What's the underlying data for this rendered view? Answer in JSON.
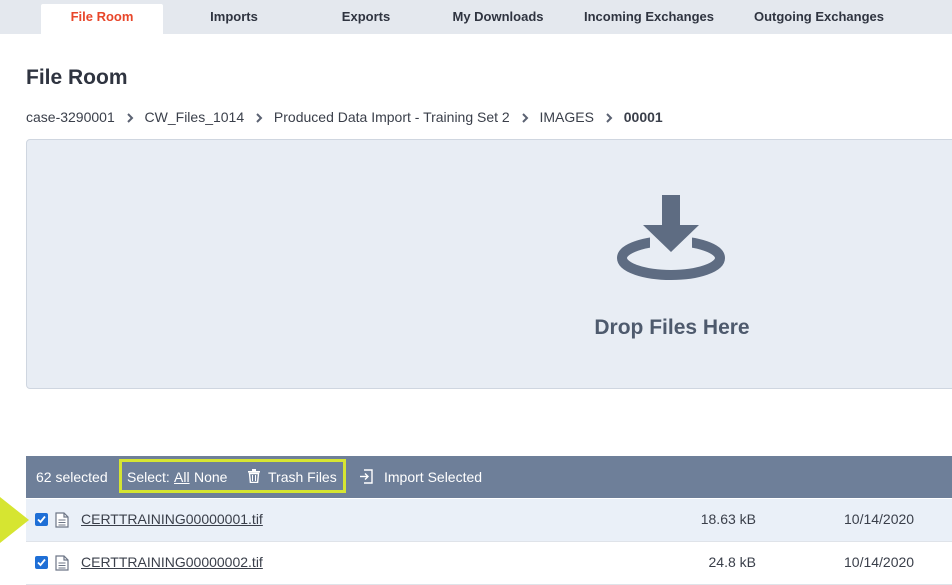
{
  "tabs": [
    {
      "label": "File Room",
      "active": true
    },
    {
      "label": "Imports"
    },
    {
      "label": "Exports"
    },
    {
      "label": "My Downloads"
    },
    {
      "label": "Incoming Exchanges"
    },
    {
      "label": "Outgoing Exchanges"
    }
  ],
  "page": {
    "title": "File Room"
  },
  "breadcrumb": [
    "case-3290001",
    "CW_Files_1014",
    "Produced Data Import - Training Set 2",
    "IMAGES",
    "00001"
  ],
  "dropzone": {
    "text": "Drop Files Here",
    "icon": "download-tray-icon"
  },
  "toolbar": {
    "selected_count": "62 selected",
    "select_label": "Select:",
    "select_all": "All",
    "select_none": "None",
    "trash_label": "Trash Files",
    "import_label": "Import Selected",
    "highlight_color": "#d6e531"
  },
  "files": [
    {
      "name": "CERTTRAINING00000001.tif",
      "size": "18.63 kB",
      "date": "10/14/2020",
      "checked": true
    },
    {
      "name": "CERTTRAINING00000002.tif",
      "size": "24.8 kB",
      "date": "10/14/2020",
      "checked": true
    }
  ],
  "colors": {
    "accent": "#e8462a",
    "toolbar": "#6e7f99",
    "checkbox": "#1f6fd6",
    "pointer": "#d6e531"
  }
}
